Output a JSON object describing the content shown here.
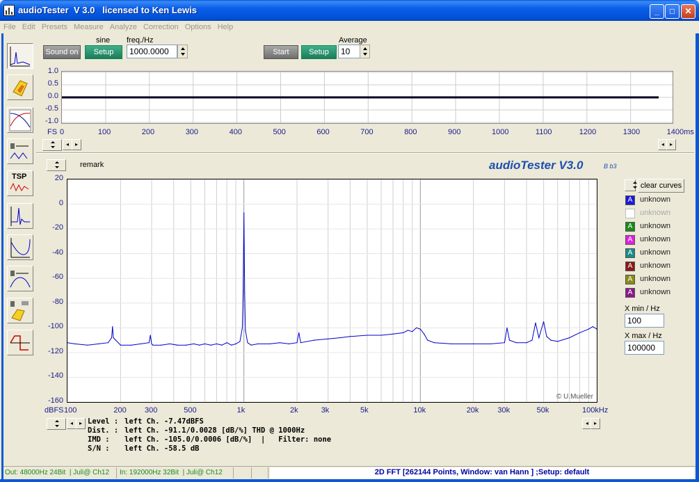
{
  "window": {
    "title": "audioTester  V 3.0   licensed to Ken Lewis",
    "controls": [
      "_",
      "□",
      "✕"
    ]
  },
  "menu": [
    "File",
    "Edit",
    "Presets",
    "Measure",
    "Analyze",
    "Correction",
    "Options",
    "Help"
  ],
  "toolbar_icons": [
    "fft-spectrum-icon",
    "speaker-yellow-icon",
    "filter-response-icon",
    "speaker-waveform-icon",
    "tsp-icon",
    "impulse-response-icon",
    "frequency-curve-icon",
    "speaker-bandpass-icon",
    "speaker-compare-icon",
    "square-wave-icon"
  ],
  "tool_tsp_label": "TSP",
  "generator": {
    "sound_button": "Sound on",
    "signal_label": "sine",
    "setup_button": "Setup",
    "freq_label": "freq./Hz",
    "freq_value": "1000.0000"
  },
  "analyzer": {
    "start_button": "Start",
    "setup_button": "Setup",
    "average_label": "Average",
    "average_value": "10"
  },
  "scope": {
    "y_ticks": [
      "1.0",
      "0.5",
      "0.0",
      "-0.5",
      "-1.0"
    ],
    "fs_label": "FS",
    "x_ticks": [
      "0",
      "100",
      "200",
      "300",
      "400",
      "500",
      "600",
      "700",
      "800",
      "900",
      "1000",
      "1100",
      "1200",
      "1300",
      "1400ms"
    ]
  },
  "remark_label": "remark",
  "brand": "audioTester V3.0",
  "brand_build": "B b3",
  "chart_data": {
    "type": "line",
    "title": "",
    "xlabel": "",
    "ylabel": "",
    "x_scale": "log",
    "xlim": [
      100,
      100000
    ],
    "ylim": [
      -160,
      20
    ],
    "y_unit_label": "dBFS",
    "x_unit_label": "kHz",
    "y_ticks": [
      "20",
      "0",
      "-20",
      "-40",
      "-60",
      "-80",
      "-100",
      "-120",
      "-140",
      "-160"
    ],
    "x_ticks": [
      "100",
      "200",
      "300",
      "500",
      "1k",
      "2k",
      "3k",
      "5k",
      "10k",
      "20k",
      "30k",
      "50k",
      "100kHz"
    ],
    "grid": true,
    "series": [
      {
        "color": "#0000cc",
        "x": [
          100,
          110,
          130,
          150,
          170,
          178,
          180,
          182,
          200,
          230,
          260,
          290,
          295,
          300,
          305,
          340,
          380,
          420,
          470,
          520,
          560,
          600,
          650,
          700,
          750,
          800,
          850,
          900,
          950,
          980,
          990,
          1000,
          1010,
          1020,
          1050,
          1100,
          1200,
          1400,
          1600,
          1800,
          2000,
          2050,
          2100,
          2500,
          3000,
          3500,
          4000,
          5000,
          6000,
          7000,
          8000,
          8500,
          9000,
          9500,
          10000,
          10500,
          11000,
          12000,
          15000,
          20000,
          25000,
          30000,
          31000,
          32000,
          35000,
          40000,
          43000,
          45000,
          47000,
          50000,
          52000,
          55000,
          60000,
          70000,
          80000,
          90000,
          95000,
          100000
        ],
        "values": [
          -112,
          -113,
          -114,
          -113,
          -112,
          -108,
          -99,
          -108,
          -114,
          -114,
          -113,
          -112,
          -106,
          -113,
          -114,
          -114,
          -113,
          -114,
          -114,
          -113,
          -114,
          -113,
          -114,
          -113,
          -114,
          -112,
          -114,
          -113,
          -111,
          -100,
          -70,
          -7,
          -72,
          -102,
          -112,
          -114,
          -113,
          -113,
          -112,
          -113,
          -112,
          -104,
          -112,
          -110,
          -109,
          -108,
          -107,
          -106,
          -106,
          -105,
          -104,
          -102,
          -103,
          -100,
          -101,
          -105,
          -110,
          -112,
          -113,
          -113,
          -113,
          -112,
          -100,
          -110,
          -112,
          -112,
          -110,
          -96,
          -108,
          -95,
          -107,
          -110,
          -111,
          -108,
          -104,
          -101,
          -99,
          -101
        ]
      }
    ]
  },
  "clear_curves_button": "clear curves",
  "legend": [
    {
      "label": "unknown",
      "letter": "A",
      "color": "#1a1ad8"
    },
    {
      "label": "unknown",
      "letter": "",
      "color": "#ffffff"
    },
    {
      "label": "unknown",
      "letter": "A",
      "color": "#1a8a1a"
    },
    {
      "label": "unknown",
      "letter": "A",
      "color": "#e020e0"
    },
    {
      "label": "unknown",
      "letter": "A",
      "color": "#1a8a8a"
    },
    {
      "label": "unknown",
      "letter": "A",
      "color": "#8a1a1a"
    },
    {
      "label": "unknown",
      "letter": "A",
      "color": "#8a8a1a"
    },
    {
      "label": "unknown",
      "letter": "A",
      "color": "#8a1a8a"
    }
  ],
  "xmin": {
    "label": "X min / Hz",
    "value": "100"
  },
  "xmax": {
    "label": "X max / Hz",
    "value": "100000"
  },
  "copyright": "© U.Mueller",
  "measurements": [
    {
      "key": "Level :",
      "value": "left Ch. -7.47dBFS"
    },
    {
      "key": "Dist. :",
      "value": "left Ch. -91.1/0.0028 [dB/%] THD @ 1000Hz"
    },
    {
      "key": "IMD :",
      "value": "left Ch. -105.0/0.0006 [dB/%]  |   Filter: none"
    },
    {
      "key": "S/N :",
      "value": "left Ch. -58.5 dB"
    }
  ],
  "status": {
    "out": "Out: 48000Hz 24Bit  | Juli@ Ch12",
    "in": "In: 192000Hz 32Bit  | Juli@ Ch12",
    "main": "2D FFT [262144 Points, Window: van Hann ]  ;Setup:  default"
  }
}
